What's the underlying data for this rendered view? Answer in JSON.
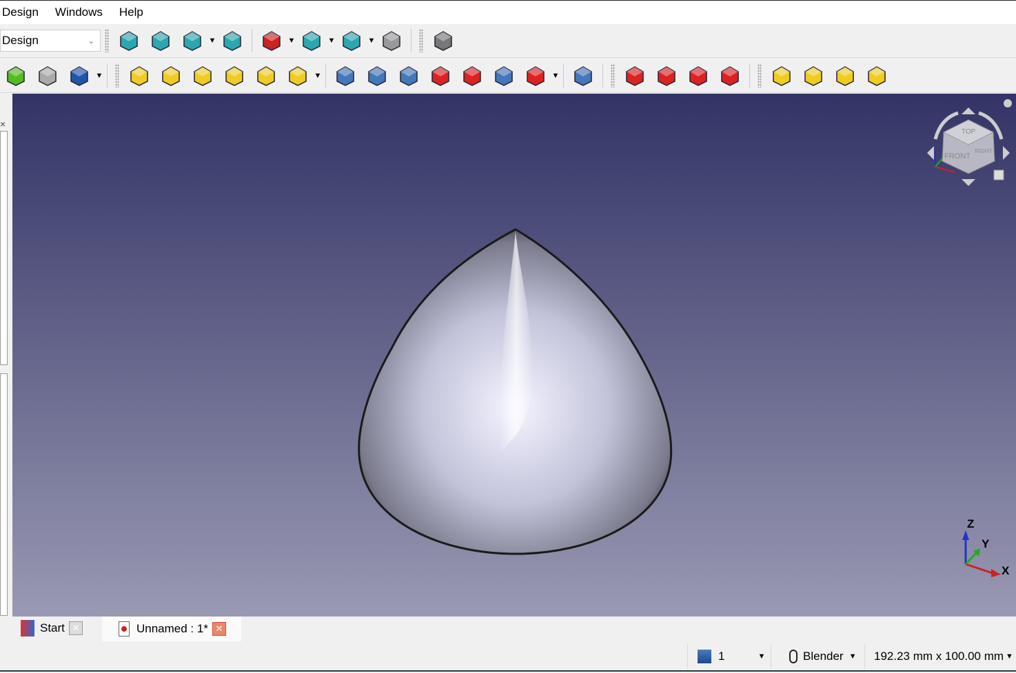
{
  "menu": [
    "Design",
    "Windows",
    "Help"
  ],
  "workbench": {
    "selected": "Design"
  },
  "toolbar1": [
    {
      "name": "fit-all-icon",
      "dropdown": false
    },
    {
      "name": "fit-selection-icon",
      "dropdown": false
    },
    {
      "name": "isometric-view-icon",
      "dropdown": true
    },
    {
      "name": "sketch-view-icon",
      "dropdown": false
    },
    {
      "name": "draw-style-icon",
      "dropdown": true
    },
    {
      "name": "box-selection-icon",
      "dropdown": true
    },
    {
      "name": "sync-view-icon",
      "dropdown": true
    },
    {
      "name": "measure-icon",
      "dropdown": false
    },
    {
      "name": "whats-this-icon",
      "dropdown": false
    }
  ],
  "toolbar2": [
    {
      "name": "shape-binder-icon",
      "color": "#55bb22"
    },
    {
      "name": "clone-icon",
      "color": "#aaaaaa"
    },
    {
      "name": "sketch-icon",
      "color": "#2255aa",
      "dropdown": true
    },
    {
      "name": "pad-icon",
      "color": "#eecc22"
    },
    {
      "name": "revolution-icon",
      "color": "#eecc22"
    },
    {
      "name": "additive-loft-icon",
      "color": "#eecc22"
    },
    {
      "name": "additive-pipe-icon",
      "color": "#eecc22"
    },
    {
      "name": "additive-helix-icon",
      "color": "#eecc22"
    },
    {
      "name": "additive-box-icon",
      "color": "#eecc22",
      "dropdown": true
    },
    {
      "name": "pocket-icon",
      "color": "#4477bb"
    },
    {
      "name": "hole-icon",
      "color": "#4477bb"
    },
    {
      "name": "groove-icon",
      "color": "#4477bb"
    },
    {
      "name": "subtractive-loft-icon",
      "color": "#dd2222"
    },
    {
      "name": "subtractive-pipe-icon",
      "color": "#dd2222"
    },
    {
      "name": "subtractive-helix-icon",
      "color": "#4477bb"
    },
    {
      "name": "subtractive-box-icon",
      "color": "#dd2222",
      "dropdown": true
    },
    {
      "name": "boolean-icon",
      "color": "#4477bb"
    },
    {
      "name": "fillet-icon",
      "color": "#dd2222"
    },
    {
      "name": "chamfer-icon",
      "color": "#dd2222"
    },
    {
      "name": "draft-icon",
      "color": "#dd2222"
    },
    {
      "name": "thickness-icon",
      "color": "#dd2222"
    },
    {
      "name": "mirrored-icon",
      "color": "#eecc22"
    },
    {
      "name": "linear-pattern-icon",
      "color": "#eecc22"
    },
    {
      "name": "polar-pattern-icon",
      "color": "#eecc22"
    },
    {
      "name": "multi-transform-icon",
      "color": "#eecc22"
    }
  ],
  "navcube": {
    "top": "TOP",
    "front": "FRONT",
    "right": "RIGHT"
  },
  "axes": {
    "x": "X",
    "y": "Y",
    "z": "Z",
    "x_color": "#cc2222",
    "y_color": "#22aa22",
    "z_color": "#2233cc"
  },
  "viewport": {
    "bg_top": "#333366",
    "bg_bottom": "#9999b3"
  },
  "tabs": [
    {
      "label": "Start",
      "active": false
    },
    {
      "label": "Unnamed : 1*",
      "active": true
    }
  ],
  "status": {
    "page": "1",
    "nav_style": "Blender",
    "dimensions": "192.23 mm x 100.00 mm"
  }
}
